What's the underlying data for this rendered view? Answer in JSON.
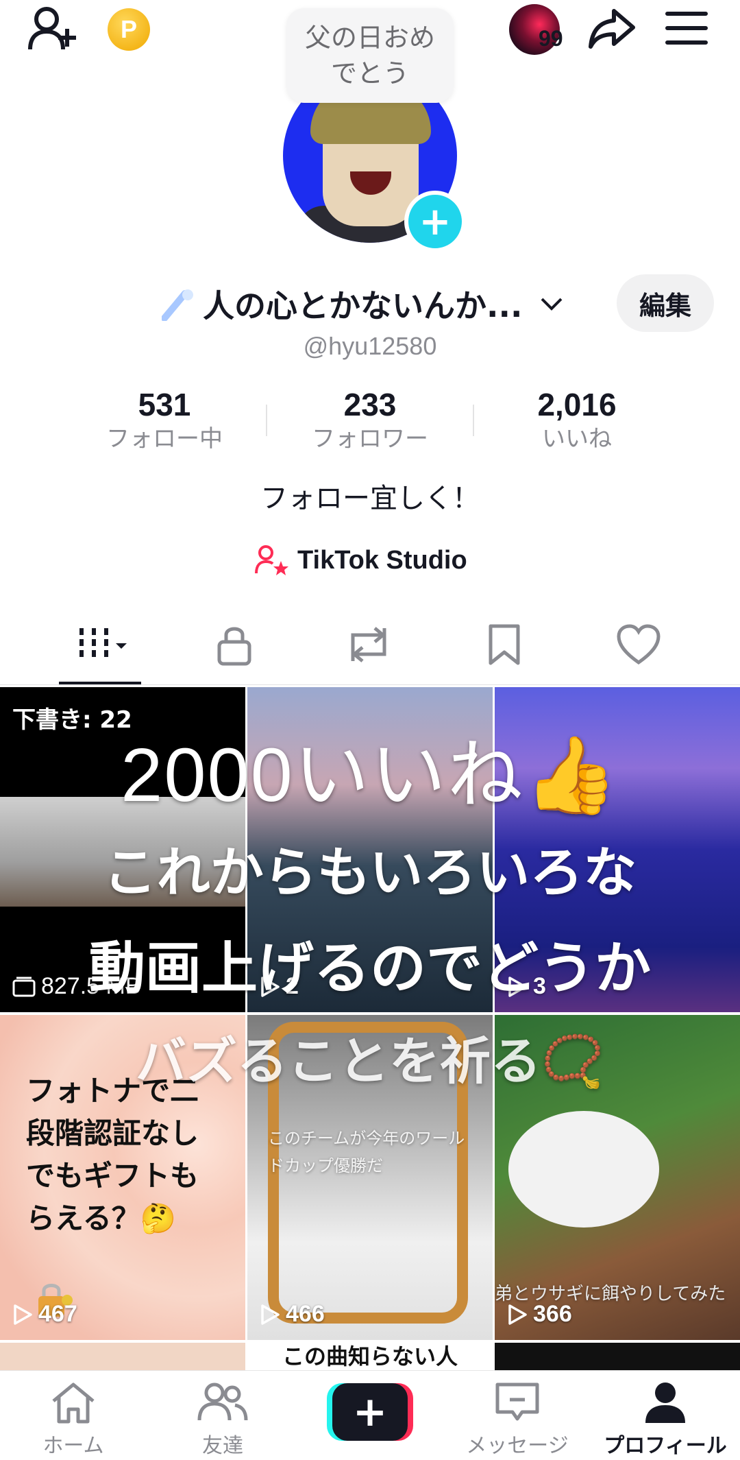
{
  "header": {
    "note_text": "父の日おめ\nでとう",
    "notification_count": "99",
    "coin_label": "P"
  },
  "profile": {
    "name": "人の心とかないんか...",
    "handle": "@hyu12580",
    "edit_label": "編集",
    "bio": "フォロー宜しく！",
    "studio_label": "TikTok Studio"
  },
  "stats": [
    {
      "value": "531",
      "label": "フォロー中"
    },
    {
      "value": "233",
      "label": "フォロワー"
    },
    {
      "value": "2,016",
      "label": "いいね"
    }
  ],
  "tabs": [
    "videos-icon",
    "lock-icon",
    "repost-icon",
    "bookmark-icon",
    "heart-icon"
  ],
  "grid": {
    "drafts_label": "下書き: 22",
    "drafts_size": "827.5 MB",
    "cells": [
      {
        "views": "2"
      },
      {
        "views": "3"
      },
      {
        "views": "467",
        "caption": "フォトナで二段階認証なしでもギフトもらえる？🤔"
      },
      {
        "views": "466",
        "caption": "このチームが今年のワールドカップ優勝だ"
      },
      {
        "views": "366",
        "caption": "弟とウサギに餌やりしてみた"
      }
    ],
    "row3_caption": "この曲知らない人"
  },
  "overlay": {
    "line1": "2000いいね👍",
    "line2": "これからもいろいろな",
    "line3": "動画上げるのでどうか",
    "line4": "バズることを祈る📿"
  },
  "bottom_nav": {
    "home": "ホーム",
    "friends": "友達",
    "messages": "メッセージ",
    "profile": "プロフィール"
  }
}
